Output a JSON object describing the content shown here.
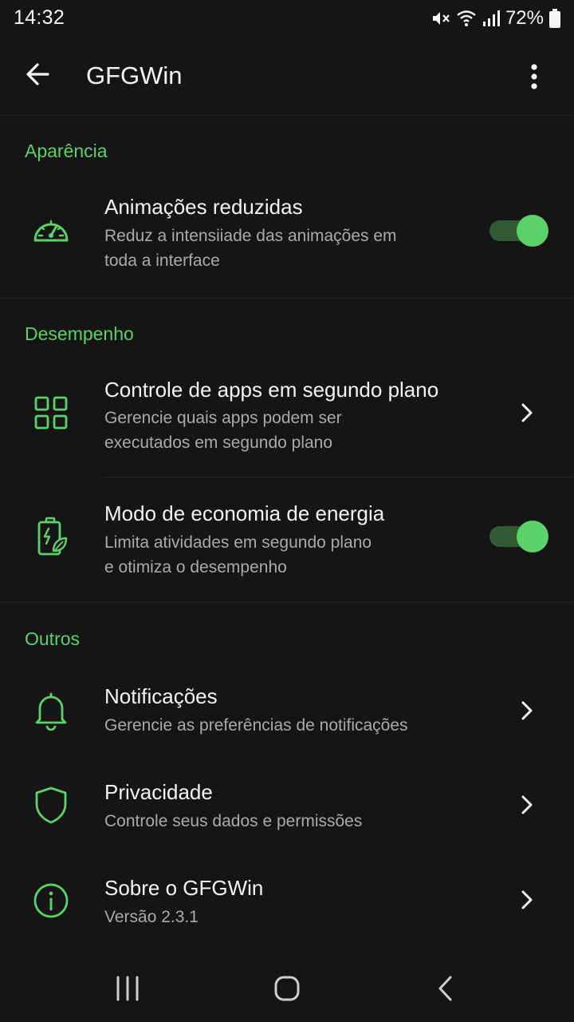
{
  "status": {
    "time": "14:32",
    "battery": "72%"
  },
  "appbar": {
    "title": "GFGWin"
  },
  "sections": {
    "appearance": "Aparência",
    "performance": "Desempenho",
    "others": "Outros"
  },
  "items": {
    "reduced_animations": {
      "title": "Animações reduzidas",
      "subtitle_line1": "Reduz a intensiiade das animações em",
      "subtitle_line2": "toda a interface",
      "toggle_on": true,
      "icon": "speedometer-icon"
    },
    "background_apps": {
      "title": "Controle de apps em segundo plano",
      "subtitle_line1": "Gerencie quais apps podem ser",
      "subtitle_line2": "executados em segundo plano",
      "icon": "grid-icon"
    },
    "battery_saver": {
      "title": "Modo de economia de energia",
      "subtitle_line1": "Limita atividades em segundo plano",
      "subtitle_line2": "e otimiza o desempenho",
      "toggle_on": true,
      "icon": "battery-leaf-icon"
    },
    "notifications": {
      "title": "Notificações",
      "subtitle": "Gerencie as preferências de notificações",
      "icon": "bell-icon"
    },
    "privacy": {
      "title": "Privacidade",
      "subtitle": "Controle seus dados e permissões",
      "icon": "shield-icon"
    },
    "about": {
      "title": "Sobre o GFGWin",
      "subtitle": "Versão 2.3.1",
      "icon": "info-icon"
    }
  },
  "colors": {
    "accent": "#5bd169",
    "background": "#151515",
    "subtitle": "#aaaaaa"
  }
}
